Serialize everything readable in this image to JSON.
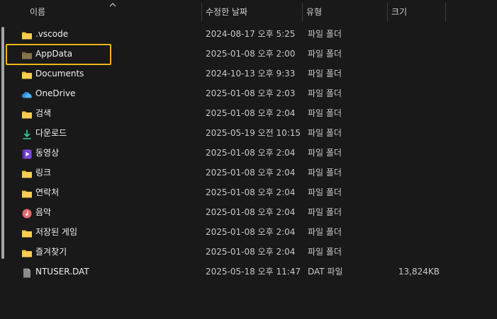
{
  "columns": {
    "name": "이름",
    "date": "수정한 날짜",
    "type": "유형",
    "size": "크기"
  },
  "accent_color": "#f0b419",
  "files": [
    {
      "name": ".vscode",
      "date": "2024-08-17 오후 5:25",
      "type": "파일 폴더",
      "size": "",
      "icon": "folder-icon"
    },
    {
      "name": "AppData",
      "date": "2025-01-08 오후 2:00",
      "type": "파일 폴더",
      "size": "",
      "icon": "folder-hidden-icon"
    },
    {
      "name": "Documents",
      "date": "2024-10-13 오후 9:33",
      "type": "파일 폴더",
      "size": "",
      "icon": "folder-icon"
    },
    {
      "name": "OneDrive",
      "date": "2025-01-08 오후 2:03",
      "type": "파일 폴더",
      "size": "",
      "icon": "onedrive-cloud-icon"
    },
    {
      "name": "검색",
      "date": "2025-01-08 오후 2:04",
      "type": "파일 폴더",
      "size": "",
      "icon": "folder-icon"
    },
    {
      "name": "다운로드",
      "date": "2025-05-19 오전 10:15",
      "type": "파일 폴더",
      "size": "",
      "icon": "download-icon"
    },
    {
      "name": "동영상",
      "date": "2025-01-08 오후 2:04",
      "type": "파일 폴더",
      "size": "",
      "icon": "video-icon"
    },
    {
      "name": "링크",
      "date": "2025-01-08 오후 2:04",
      "type": "파일 폴더",
      "size": "",
      "icon": "folder-icon"
    },
    {
      "name": "연락처",
      "date": "2025-01-08 오후 2:04",
      "type": "파일 폴더",
      "size": "",
      "icon": "folder-icon"
    },
    {
      "name": "음악",
      "date": "2025-01-08 오후 2:04",
      "type": "파일 폴더",
      "size": "",
      "icon": "music-icon"
    },
    {
      "name": "저장된 게임",
      "date": "2025-01-08 오후 2:04",
      "type": "파일 폴더",
      "size": "",
      "icon": "folder-icon"
    },
    {
      "name": "즐겨찾기",
      "date": "2025-01-08 오후 2:04",
      "type": "파일 폴더",
      "size": "",
      "icon": "folder-icon"
    },
    {
      "name": "NTUSER.DAT",
      "date": "2025-05-18 오후 11:47",
      "type": "DAT 파일",
      "size": "13,824KB",
      "icon": "file-icon"
    }
  ]
}
